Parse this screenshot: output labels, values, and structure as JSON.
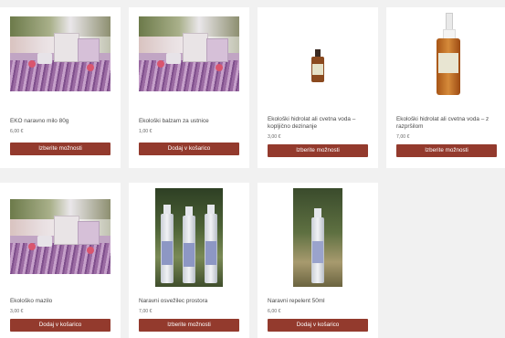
{
  "products": [
    {
      "title": "EKO naravno milo 80g",
      "price": "6,00 €",
      "button": "Izberite možnosti",
      "image": "lavender-gift-box"
    },
    {
      "title": "Ekološki balzam za ustnice",
      "price": "1,00 €",
      "button": "Dodaj v košarico",
      "image": "lavender-gift-box"
    },
    {
      "title": "Ekološki hidrolat ali cvetna voda – kopljično dezinanje",
      "price": "3,00 €",
      "button": "Izberite možnosti",
      "image": "small-amber-bottle"
    },
    {
      "title": "Ekološki hidrolat ali cvetna voda – z razpršilom",
      "price": "7,00 €",
      "button": "Izberite možnosti",
      "image": "amber-spray-bottle"
    },
    {
      "title": "Ekološko mazilo",
      "price": "3,00 €",
      "button": "Dodaj v košarico",
      "image": "lavender-gift-box"
    },
    {
      "title": "Naravni osvežilec prostora",
      "price": "7,00 €",
      "button": "Izberite možnosti",
      "image": "three-spray-bottles"
    },
    {
      "title": "Naravni repelent 50ml",
      "price": "6,00 €",
      "button": "Dodaj v košarico",
      "image": "single-spray-bottle"
    }
  ],
  "colors": {
    "button": "#933a2d",
    "background": "#f1f1f1",
    "card": "#ffffff"
  }
}
